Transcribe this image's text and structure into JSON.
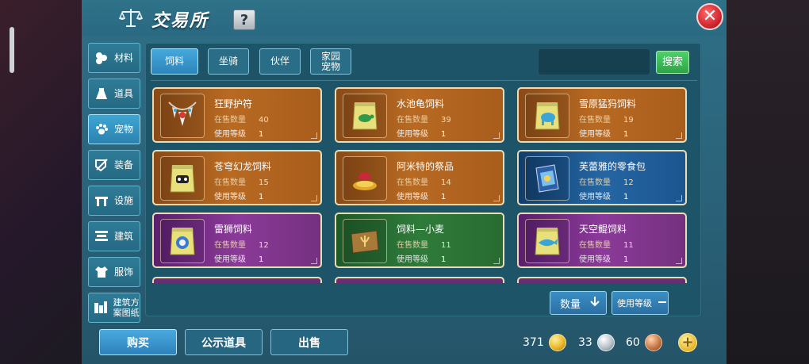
{
  "window": {
    "title": "交易所",
    "help_label": "?",
    "close_label": "✕"
  },
  "sidebar": {
    "items": [
      {
        "label": "材料",
        "icon": "material-icon",
        "active": false
      },
      {
        "label": "道具",
        "icon": "item-icon",
        "active": false
      },
      {
        "label": "宠物",
        "icon": "pet-paw-icon",
        "active": true
      },
      {
        "label": "装备",
        "icon": "equipment-icon",
        "active": false
      },
      {
        "label": "设施",
        "icon": "facility-icon",
        "active": false
      },
      {
        "label": "建筑",
        "icon": "building-icon",
        "active": false
      },
      {
        "label": "服饰",
        "icon": "clothing-icon",
        "active": false
      },
      {
        "label": "建筑方案图纸",
        "icon": "blueprint-icon",
        "active": false
      }
    ]
  },
  "tabs": [
    {
      "label": "饲料",
      "active": true
    },
    {
      "label": "坐骑",
      "active": false
    },
    {
      "label": "伙伴",
      "active": false
    },
    {
      "label": "家园宠物",
      "active": false
    }
  ],
  "search": {
    "value": "",
    "button_label": "搜索"
  },
  "item_labels": {
    "stock": "在售数量",
    "level": "使用等级"
  },
  "items": [
    {
      "name": "狂野护符",
      "stock": "40",
      "level": "1",
      "color": "orange",
      "icon": "wild-amulet-icon"
    },
    {
      "name": "水池龟饲料",
      "stock": "39",
      "level": "1",
      "color": "orange",
      "icon": "turtle-feed-bag-icon"
    },
    {
      "name": "雪原猛犸饲料",
      "stock": "19",
      "level": "1",
      "color": "orange",
      "icon": "mammoth-feed-bag-icon"
    },
    {
      "name": "苍穹幻龙饲料",
      "stock": "15",
      "level": "1",
      "color": "orange",
      "icon": "dragon-feed-bag-icon"
    },
    {
      "name": "阿米特的祭品",
      "stock": "14",
      "level": "1",
      "color": "orange",
      "icon": "offering-icon"
    },
    {
      "name": "芙蕾雅的零食包",
      "stock": "12",
      "level": "1",
      "color": "blue",
      "icon": "snack-pack-icon"
    },
    {
      "name": "雷狮饲料",
      "stock": "12",
      "level": "1",
      "color": "purple",
      "icon": "lion-feed-bag-icon"
    },
    {
      "name": "饲料—小麦",
      "stock": "11",
      "level": "1",
      "color": "green",
      "icon": "wheat-sack-icon"
    },
    {
      "name": "天空鲲饲料",
      "stock": "11",
      "level": "1",
      "color": "purple",
      "icon": "sky-whale-feed-bag-icon"
    }
  ],
  "sort": {
    "quantity_label": "数量",
    "level_label": "使用等级"
  },
  "footer": {
    "buy_label": "购买",
    "listed_label": "公示道具",
    "sell_label": "出售"
  },
  "currency": {
    "gold": "371",
    "silver": "33",
    "bronze": "60",
    "add_label": "+"
  },
  "colors": {
    "window_bg": "#2a6a82",
    "active_tab": "#3fa5d2",
    "search_button": "#3fbf5a",
    "card_orange": "#b86a22",
    "card_blue": "#2466a3",
    "card_purple": "#8b3a99",
    "card_green": "#2f7b3a",
    "close_button": "#d8262f"
  }
}
